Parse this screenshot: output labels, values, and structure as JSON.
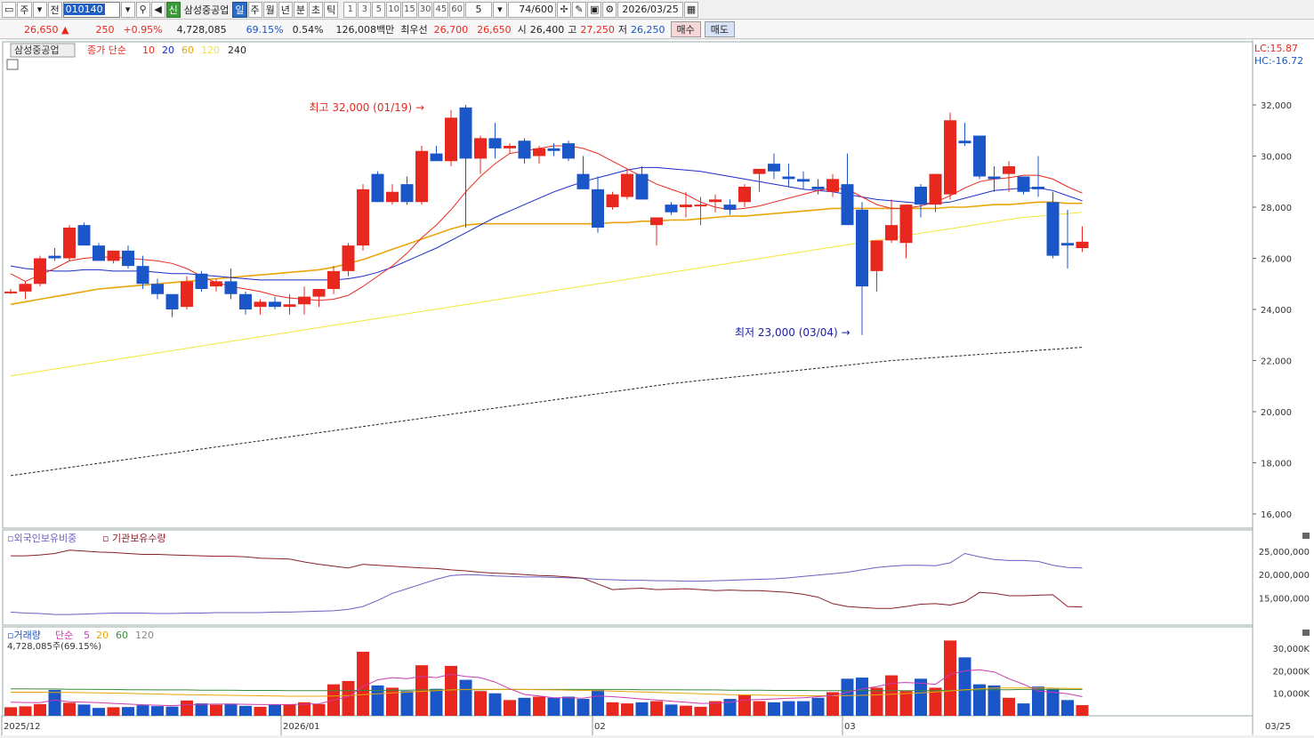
{
  "toolbar": {
    "market_label": "주",
    "mode_label": "전",
    "code": "010140",
    "new_badge": "신",
    "stock_name": "삼성중공업",
    "periods": [
      "일",
      "주",
      "월",
      "년",
      "분",
      "초",
      "틱"
    ],
    "active_period": "일",
    "intervals": [
      "1",
      "3",
      "5",
      "10",
      "15",
      "30",
      "45",
      "60"
    ],
    "interval_value": "5",
    "count": "74",
    "count_max": "/600",
    "date": "2026/03/25"
  },
  "quote": {
    "price": "26,650",
    "change_arrow": "▲",
    "change": "250",
    "change_pct": "+0.95%",
    "volume": "4,728,085",
    "vol_ratio": "69.15%",
    "turnover": "0.54%",
    "amount": "126,008백만",
    "bid_label": "최우선",
    "ask": "26,700",
    "bid": "26,650",
    "open_label": "시",
    "open": "26,400",
    "high_label": "고",
    "high": "27,250",
    "low_label": "저",
    "low": "26,250",
    "buy_label": "매수",
    "sell_label": "매도"
  },
  "legend": {
    "stock": "삼성중공업",
    "ma_prefix": "종가 단순",
    "ma_periods": [
      "10",
      "20",
      "60",
      "120",
      "240"
    ],
    "lc": "LC:15.87",
    "hc": "HC:-16.72",
    "max_note": "최고 32,000 (01/19)",
    "min_note": "최저 23,000 (03/04)"
  },
  "sub_panel": {
    "foreign_label": "외국인보유비중",
    "inst_label": "기관보유수량",
    "ticks": [
      "25,000,000",
      "20,000,000",
      "15,000,000"
    ]
  },
  "volume_panel": {
    "label": "거래량",
    "ma_prefix": "단순",
    "ma_periods": [
      "5",
      "20",
      "60",
      "120"
    ],
    "current": "4,728,085주(69.15%)",
    "ticks": [
      "30,000K",
      "20,000K",
      "10,000K"
    ]
  },
  "x_axis": [
    "2025/12",
    "2026/01",
    "02",
    "03"
  ],
  "x_right": "03/25",
  "colors": {
    "up": "#e8281e",
    "down": "#1b56c9",
    "ma10": "#e8281e",
    "ma20": "#1c2bcc",
    "ma60": "#e8a60c",
    "ma120": "#f2e53b",
    "ma240": "#222222",
    "foreign": "#6b5fc0",
    "inst": "#8a1f2b"
  },
  "chart_data": {
    "type": "candlestick",
    "y_ticks": [
      32000,
      30000,
      28000,
      26000,
      24000,
      22000,
      20000,
      18000,
      16000
    ],
    "ylim": [
      15500,
      34000
    ],
    "candles": [
      [
        24700,
        24800,
        24600,
        24700
      ],
      [
        24700,
        25100,
        24400,
        25000
      ],
      [
        25000,
        26100,
        24900,
        26000
      ],
      [
        26100,
        26400,
        25900,
        26000
      ],
      [
        26000,
        27300,
        25900,
        27200
      ],
      [
        27300,
        27400,
        26500,
        26500
      ],
      [
        26500,
        26600,
        25900,
        25900
      ],
      [
        25900,
        26300,
        25800,
        26300
      ],
      [
        26300,
        26500,
        25600,
        25700
      ],
      [
        25700,
        26100,
        24800,
        25000
      ],
      [
        25000,
        25200,
        24400,
        24600
      ],
      [
        24600,
        24600,
        23700,
        24000
      ],
      [
        24100,
        25300,
        24000,
        25100
      ],
      [
        25400,
        25500,
        24700,
        24800
      ],
      [
        24900,
        25200,
        24700,
        25100
      ],
      [
        25100,
        25600,
        24400,
        24600
      ],
      [
        24600,
        24700,
        23800,
        24000
      ],
      [
        24100,
        24400,
        23800,
        24300
      ],
      [
        24300,
        24500,
        24000,
        24100
      ],
      [
        24100,
        24600,
        23800,
        24200
      ],
      [
        24200,
        24900,
        23800,
        24500
      ],
      [
        24500,
        24800,
        24100,
        24800
      ],
      [
        24800,
        25700,
        24600,
        25500
      ],
      [
        25500,
        26600,
        25300,
        26500
      ],
      [
        26500,
        28900,
        26300,
        28700
      ],
      [
        29300,
        29400,
        28200,
        28200
      ],
      [
        28200,
        28900,
        28100,
        28600
      ],
      [
        28900,
        29200,
        28100,
        28200
      ],
      [
        28200,
        30400,
        28100,
        30200
      ],
      [
        30100,
        30400,
        29800,
        29800
      ],
      [
        29800,
        31800,
        29600,
        31500
      ],
      [
        31900,
        32000,
        27200,
        29900
      ],
      [
        29900,
        30800,
        29300,
        30700
      ],
      [
        30700,
        31300,
        29900,
        30300
      ],
      [
        30300,
        30500,
        30100,
        30400
      ],
      [
        30600,
        30700,
        29700,
        29900
      ],
      [
        30000,
        30400,
        29700,
        30300
      ],
      [
        30300,
        30500,
        30000,
        30200
      ],
      [
        30500,
        30600,
        29800,
        29900
      ],
      [
        29300,
        30000,
        28900,
        28700
      ],
      [
        28700,
        29200,
        27000,
        27200
      ],
      [
        28000,
        28600,
        27900,
        28500
      ],
      [
        28400,
        29500,
        28300,
        29300
      ],
      [
        29300,
        29600,
        28300,
        28300
      ],
      [
        27300,
        27600,
        26500,
        27600
      ],
      [
        28100,
        28200,
        27700,
        27800
      ],
      [
        28000,
        28600,
        27600,
        28100
      ],
      [
        28100,
        28400,
        27300,
        28100
      ],
      [
        28200,
        28500,
        27800,
        28300
      ],
      [
        28100,
        28300,
        27700,
        27900
      ],
      [
        28200,
        28900,
        28000,
        28800
      ],
      [
        29300,
        29500,
        28600,
        29500
      ],
      [
        29700,
        30100,
        29100,
        29400
      ],
      [
        29200,
        29700,
        28800,
        29100
      ],
      [
        29100,
        29400,
        28700,
        29000
      ],
      [
        28800,
        29100,
        28500,
        28700
      ],
      [
        28600,
        29300,
        28400,
        29100
      ],
      [
        28900,
        30100,
        28500,
        27300
      ],
      [
        27900,
        28200,
        23000,
        24900
      ],
      [
        25500,
        26500,
        24700,
        26700
      ],
      [
        26700,
        28300,
        26600,
        27300
      ],
      [
        26600,
        28100,
        26000,
        28100
      ],
      [
        28800,
        28900,
        27600,
        28100
      ],
      [
        28100,
        29300,
        27800,
        29300
      ],
      [
        28500,
        31700,
        28300,
        31400
      ],
      [
        30600,
        31300,
        30400,
        30500
      ],
      [
        30800,
        30800,
        29100,
        29200
      ],
      [
        29200,
        29600,
        28600,
        29100
      ],
      [
        29300,
        29800,
        28600,
        29600
      ],
      [
        29200,
        29200,
        28500,
        28600
      ],
      [
        28800,
        30000,
        28400,
        28700
      ],
      [
        28200,
        28600,
        26000,
        26100
      ],
      [
        26600,
        27900,
        25600,
        26500
      ],
      [
        26400,
        27250,
        26250,
        26650
      ]
    ],
    "ma10": [
      25400,
      25100,
      25350,
      25600,
      25900,
      26000,
      26050,
      26050,
      26000,
      25950,
      25900,
      25800,
      25600,
      25300,
      25050,
      24900,
      24800,
      24700,
      24550,
      24450,
      24400,
      24350,
      24400,
      24550,
      24900,
      25300,
      25700,
      26200,
      26800,
      27300,
      27900,
      28600,
      29200,
      29700,
      30100,
      30200,
      30300,
      30400,
      30400,
      30300,
      30100,
      29800,
      29500,
      29200,
      28900,
      28700,
      28500,
      28200,
      28000,
      27900,
      27950,
      28050,
      28200,
      28350,
      28500,
      28650,
      28750,
      28700,
      28400,
      28100,
      27950,
      27950,
      28050,
      28200,
      28450,
      28750,
      29000,
      29100,
      29150,
      29250,
      29250,
      29100,
      28800,
      28550
    ],
    "ma20": [
      25700,
      25600,
      25550,
      25500,
      25500,
      25550,
      25550,
      25500,
      25500,
      25500,
      25450,
      25400,
      25400,
      25350,
      25300,
      25250,
      25200,
      25150,
      25150,
      25150,
      25150,
      25150,
      25150,
      25200,
      25300,
      25450,
      25650,
      25900,
      26150,
      26400,
      26700,
      27000,
      27300,
      27600,
      27850,
      28100,
      28350,
      28600,
      28800,
      29000,
      29150,
      29300,
      29450,
      29550,
      29550,
      29500,
      29450,
      29400,
      29300,
      29200,
      29100,
      29000,
      28900,
      28800,
      28700,
      28650,
      28600,
      28500,
      28400,
      28300,
      28250,
      28200,
      28150,
      28150,
      28200,
      28350,
      28500,
      28650,
      28700,
      28750,
      28750,
      28650,
      28450,
      28250
    ],
    "ma60": [
      24200,
      24300,
      24400,
      24500,
      24600,
      24700,
      24800,
      24850,
      24900,
      24950,
      25000,
      25050,
      25100,
      25150,
      25200,
      25250,
      25300,
      25350,
      25400,
      25450,
      25500,
      25550,
      25650,
      25800,
      25950,
      26150,
      26350,
      26550,
      26750,
      26950,
      27150,
      27300,
      27350,
      27350,
      27350,
      27350,
      27350,
      27350,
      27350,
      27350,
      27350,
      27400,
      27400,
      27450,
      27450,
      27500,
      27500,
      27550,
      27600,
      27650,
      27650,
      27700,
      27750,
      27800,
      27850,
      27900,
      27950,
      27950,
      27950,
      27950,
      27950,
      27950,
      27950,
      27950,
      28000,
      28000,
      28050,
      28100,
      28100,
      28150,
      28200,
      28200,
      28150,
      28150
    ],
    "ma120": [
      21400,
      21490,
      21580,
      21670,
      21760,
      21850,
      21940,
      22030,
      22120,
      22210,
      22300,
      22390,
      22480,
      22570,
      22660,
      22750,
      22840,
      22930,
      23020,
      23110,
      23200,
      23290,
      23380,
      23470,
      23560,
      23650,
      23740,
      23830,
      23920,
      24010,
      24100,
      24190,
      24280,
      24370,
      24460,
      24550,
      24640,
      24730,
      24820,
      24910,
      25000,
      25090,
      25180,
      25270,
      25360,
      25450,
      25540,
      25630,
      25720,
      25810,
      25900,
      25990,
      26080,
      26170,
      26260,
      26350,
      26440,
      26530,
      26620,
      26710,
      26800,
      26890,
      26980,
      27070,
      27160,
      27250,
      27340,
      27430,
      27520,
      27600,
      27650,
      27700,
      27750,
      27800
    ],
    "ma240": [
      17500,
      17580,
      17660,
      17740,
      17820,
      17900,
      17980,
      18060,
      18140,
      18220,
      18300,
      18380,
      18460,
      18540,
      18620,
      18700,
      18780,
      18860,
      18940,
      19020,
      19100,
      19180,
      19260,
      19340,
      19420,
      19500,
      19580,
      19660,
      19740,
      19820,
      19900,
      19980,
      20060,
      20140,
      20220,
      20300,
      20380,
      20460,
      20540,
      20620,
      20700,
      20780,
      20860,
      20940,
      21020,
      21100,
      21160,
      21220,
      21280,
      21340,
      21400,
      21460,
      21520,
      21580,
      21640,
      21700,
      21760,
      21820,
      21880,
      21940,
      22000,
      22040,
      22080,
      22120,
      22160,
      22200,
      22240,
      22280,
      22320,
      22360,
      22400,
      22440,
      22480,
      22520
    ],
    "volume": [
      3800,
      4200,
      5200,
      11500,
      5800,
      5000,
      3500,
      3800,
      3900,
      4700,
      4300,
      4100,
      6800,
      5500,
      4900,
      5400,
      4400,
      4000,
      4900,
      5100,
      6000,
      5200,
      14000,
      15500,
      28500,
      13500,
      12500,
      11000,
      22500,
      12000,
      22200,
      16000,
      11000,
      10000,
      7000,
      8000,
      8500,
      8000,
      8500,
      7500,
      11500,
      6000,
      5500,
      6000,
      6500,
      5000,
      4500,
      4000,
      6500,
      7500,
      9500,
      6500,
      6000,
      6500,
      6500,
      8000,
      10500,
      16500,
      17000,
      12500,
      18000,
      11000,
      16500,
      12500,
      33500,
      26000,
      14000,
      13500,
      8000,
      5500,
      13000,
      12000,
      7000,
      4728
    ],
    "vol_ma5": [
      6000,
      5900,
      5800,
      7000,
      6200,
      6000,
      5800,
      5500,
      5200,
      4900,
      4700,
      4500,
      4900,
      5100,
      5200,
      5200,
      5100,
      5000,
      5000,
      5000,
      5200,
      5300,
      7000,
      8500,
      13000,
      16000,
      17000,
      16500,
      17500,
      17000,
      18500,
      17500,
      17000,
      15000,
      12000,
      9500,
      8800,
      8000,
      8000,
      7800,
      8800,
      8500,
      8000,
      7500,
      7000,
      6500,
      6000,
      5500,
      5600,
      6000,
      7000,
      7200,
      7500,
      7800,
      8000,
      8500,
      9000,
      10500,
      12000,
      13000,
      14500,
      14800,
      14500,
      14000,
      18500,
      20000,
      20500,
      19500,
      16500,
      14000,
      11000,
      10500,
      9800,
      8500
    ],
    "vol_ma20": [
      10500,
      10500,
      10500,
      10400,
      10400,
      10300,
      10200,
      10100,
      10000,
      9800,
      9700,
      9500,
      9400,
      9300,
      9200,
      9100,
      9000,
      8900,
      8800,
      8700,
      8700,
      8700,
      8800,
      9000,
      9400,
      9800,
      10200,
      10500,
      10900,
      11200,
      11500,
      11700,
      11800,
      11800,
      11800,
      11700,
      11600,
      11500,
      11400,
      11300,
      11200,
      11000,
      10800,
      10600,
      10400,
      10200,
      10000,
      9800,
      9600,
      9400,
      9300,
      9200,
      9100,
      9000,
      8900,
      8900,
      8900,
      9000,
      9100,
      9300,
      9600,
      9900,
      10200,
      10600,
      11100,
      11600,
      12000,
      12300,
      12400,
      12400,
      12400,
      12300,
      12200,
      12100
    ],
    "vol_ma60": [
      12000,
      12000,
      11900,
      11900,
      11800,
      11800,
      11700,
      11700,
      11600,
      11600,
      11500,
      11500,
      11500,
      11400,
      11400,
      11400,
      11300,
      11300,
      11300,
      11200,
      11200,
      11200,
      11200,
      11200,
      11300,
      11300,
      11400,
      11400,
      11500,
      11500,
      11600,
      11600,
      11600,
      11700,
      11700,
      11700,
      11700,
      11700,
      11700,
      11700,
      11700,
      11700,
      11700,
      11600,
      11600,
      11600,
      11500,
      11500,
      11500,
      11400,
      11400,
      11400,
      11300,
      11300,
      11300,
      11200,
      11200,
      11200,
      11200,
      11200,
      11200,
      11200,
      11200,
      11200,
      11300,
      11400,
      11500,
      11600,
      11600,
      11700,
      11700,
      11700,
      11700,
      11700
    ],
    "foreign": [
      12000,
      11800,
      11700,
      11500,
      11500,
      11600,
      11700,
      11800,
      11800,
      11800,
      11700,
      11700,
      11800,
      11800,
      11900,
      11900,
      11900,
      11900,
      12000,
      12000,
      12100,
      12200,
      12300,
      12600,
      13200,
      14500,
      16000,
      17000,
      18000,
      19000,
      19800,
      20000,
      19900,
      19700,
      19600,
      19500,
      19500,
      19400,
      19300,
      19200,
      19000,
      18900,
      18800,
      18800,
      18700,
      18700,
      18600,
      18600,
      18700,
      18800,
      18900,
      19000,
      19100,
      19300,
      19600,
      19900,
      20200,
      20500,
      21000,
      21500,
      21800,
      22000,
      22000,
      21900,
      22500,
      24500,
      23800,
      23200,
      23000,
      23000,
      22800,
      22000,
      21500,
      21400
    ],
    "inst": [
      24000,
      24000,
      24200,
      24500,
      25200,
      25000,
      24800,
      24700,
      24500,
      24300,
      24300,
      24200,
      24100,
      24000,
      23900,
      23900,
      23800,
      23500,
      23400,
      23300,
      22700,
      22200,
      21800,
      21400,
      22200,
      22000,
      21800,
      21600,
      21400,
      21300,
      21000,
      20800,
      20500,
      20300,
      20200,
      20000,
      19800,
      19700,
      19500,
      19200,
      18000,
      16800,
      17000,
      17100,
      16800,
      16900,
      17000,
      16800,
      16600,
      16700,
      16600,
      16600,
      16400,
      16200,
      15800,
      15200,
      13800,
      13200,
      13000,
      12800,
      12800,
      13200,
      13700,
      13800,
      13500,
      14200,
      16200,
      16000,
      15500,
      15500,
      15600,
      15700,
      13200,
      13100
    ],
    "sub_ylim": [
      10000,
      28000
    ],
    "vol_ylim": [
      0,
      38000
    ]
  }
}
